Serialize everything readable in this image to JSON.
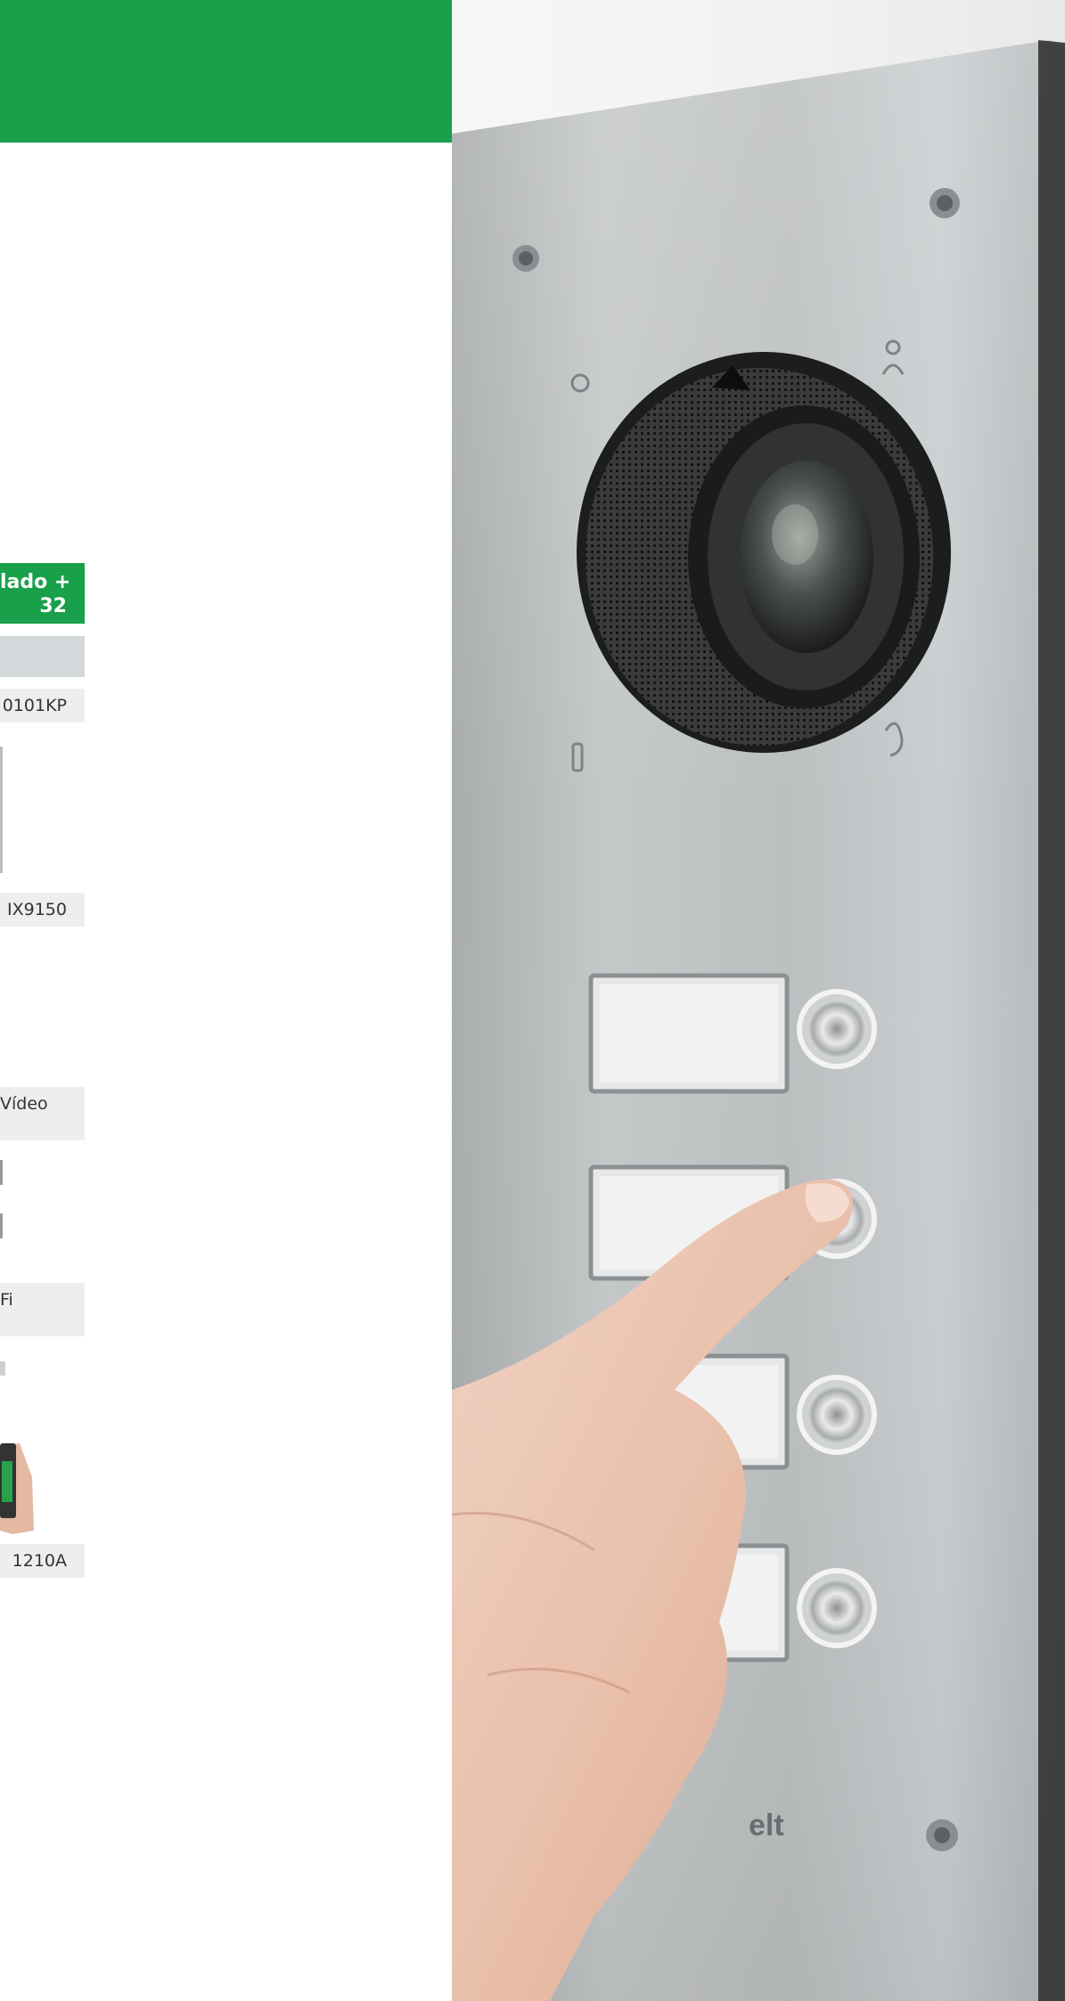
{
  "table": {
    "header_line1": "lado +",
    "header_line2": "32",
    "row_codes": [
      "0101KP",
      "IX9150",
      "Vídeo",
      "Fi",
      "1210A"
    ]
  },
  "photo": {
    "brand_text": "elt"
  },
  "colors": {
    "brand_green": "#18a04a",
    "panel_steel": "#b9bcbd",
    "table_row_bg": "#eceeef",
    "table_subhead_bg": "#d3d8db"
  },
  "icons": [
    "light-bulb-icon",
    "person-icon",
    "hearing-aid-icon",
    "key-icon"
  ]
}
